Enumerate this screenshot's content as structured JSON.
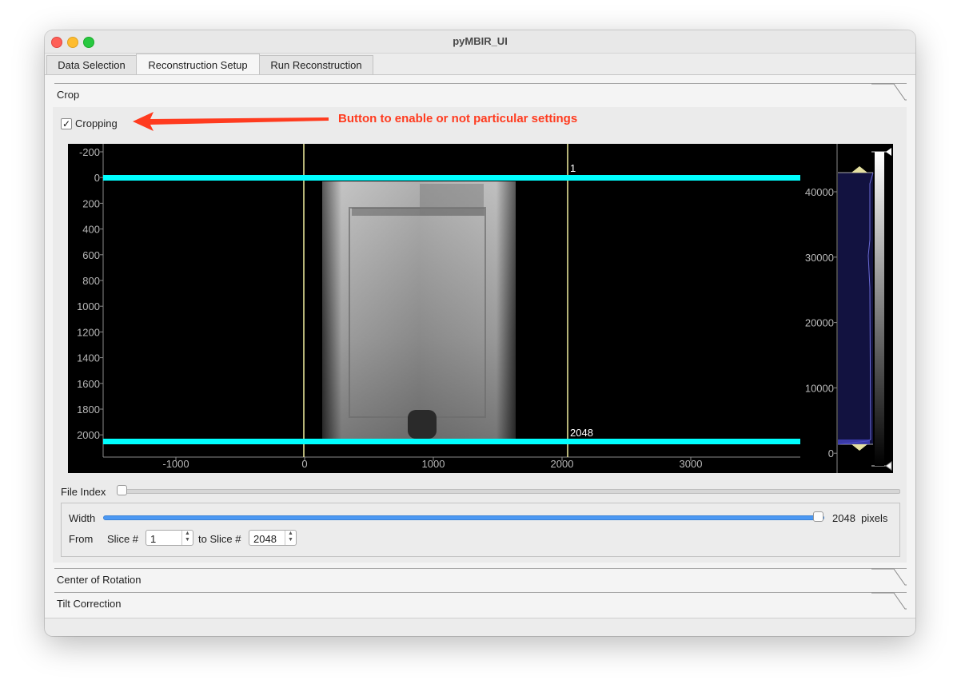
{
  "window": {
    "title": "pyMBIR_UI"
  },
  "tabs": [
    {
      "label": "Data Selection",
      "active": false
    },
    {
      "label": "Reconstruction Setup",
      "active": true
    },
    {
      "label": "Run Reconstruction",
      "active": false
    }
  ],
  "sections": {
    "crop": {
      "title": "Crop"
    },
    "center_of_rotation": {
      "title": "Center of Rotation"
    },
    "tilt_correction": {
      "title": "Tilt Correction"
    }
  },
  "crop": {
    "cropping_label": "Cropping",
    "cropping_checked": true,
    "annotation": "Button to enable or not  particular settings",
    "annotation_color": "#ff3b1f",
    "image_view": {
      "y_ticks": [
        "-200",
        "0",
        "200",
        "400",
        "600",
        "800",
        "1000",
        "1200",
        "1400",
        "1600",
        "1800",
        "2000"
      ],
      "x_ticks": [
        "-1000",
        "0",
        "1000",
        "2000",
        "3000"
      ],
      "roi_top_label": "1",
      "roi_bottom_label": "2048",
      "roi_color": "#00ffff",
      "vline_color": "#f3f0a0",
      "hist_ticks": [
        "40000",
        "30000",
        "20000",
        "10000",
        "0"
      ]
    },
    "file_index": {
      "label": "File Index",
      "value_fraction": 0.0
    },
    "width": {
      "label": "Width",
      "value": "2048",
      "unit": "pixels",
      "value_fraction": 1.0
    },
    "from_label": "From",
    "slice_label": "Slice #",
    "to_slice_label": "to Slice #",
    "from_slice": "1",
    "to_slice": "2048"
  }
}
